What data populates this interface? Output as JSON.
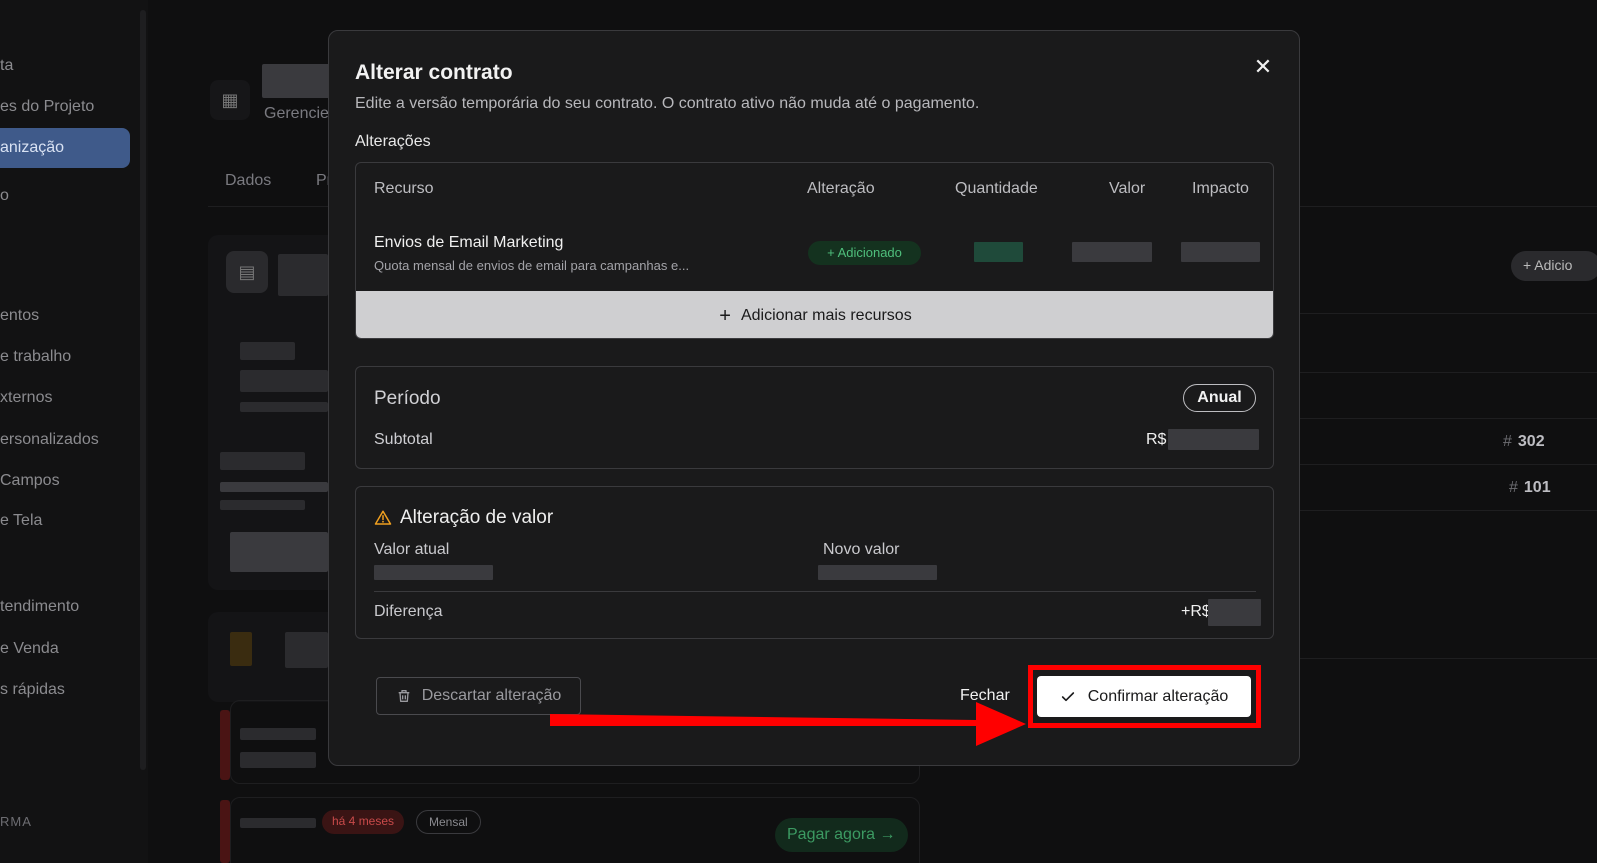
{
  "sidebar": {
    "items": [
      {
        "label": "ta"
      },
      {
        "label": "es do Projeto"
      },
      {
        "label": "anização"
      },
      {
        "label": "o"
      },
      {
        "label": "entos"
      },
      {
        "label": "e trabalho"
      },
      {
        "label": "xternos"
      },
      {
        "label": "ersonalizados"
      },
      {
        "label": "Campos"
      },
      {
        "label": "e Tela"
      },
      {
        "label": "tendimento"
      },
      {
        "label": "e Venda"
      },
      {
        "label": "s rápidas"
      }
    ],
    "section_label": "RMA"
  },
  "background": {
    "header_sub": "Gerencie",
    "tabs": [
      "Dados",
      "Pr"
    ],
    "add_chip": "+ Adicio",
    "row_numbers": [
      {
        "hash": "#",
        "value": "302"
      },
      {
        "hash": "#",
        "value": "101"
      }
    ],
    "badge_overdue": "há 4 meses",
    "badge_period": "Mensal",
    "pay_now": "Pagar agora →"
  },
  "modal": {
    "title": "Alterar contrato",
    "subtitle": "Edite a versão temporária do seu contrato. O contrato ativo não muda até o pagamento.",
    "changes_label": "Alterações",
    "table": {
      "headers": [
        "Recurso",
        "Alteração",
        "Quantidade",
        "Valor",
        "Impacto"
      ],
      "rows": [
        {
          "name": "Envios de Email Marketing",
          "description": "Quota mensal de envios de email para campanhas e...",
          "change": "+ Adicionado"
        }
      ],
      "add_more_label": "Adicionar mais recursos"
    },
    "period": {
      "label": "Período",
      "value": "Anual",
      "subtotal_label": "Subtotal",
      "currency": "R$"
    },
    "value_change": {
      "title": "Alteração de valor",
      "current_label": "Valor atual",
      "new_label": "Novo valor",
      "difference_label": "Diferença",
      "difference_prefix": "+R$"
    },
    "buttons": {
      "discard": "Descartar alteração",
      "close": "Fechar",
      "confirm": "Confirmar alteração"
    }
  },
  "colors": {
    "annotation_red": "#ff0000",
    "added_green": "#4fbf7c"
  }
}
